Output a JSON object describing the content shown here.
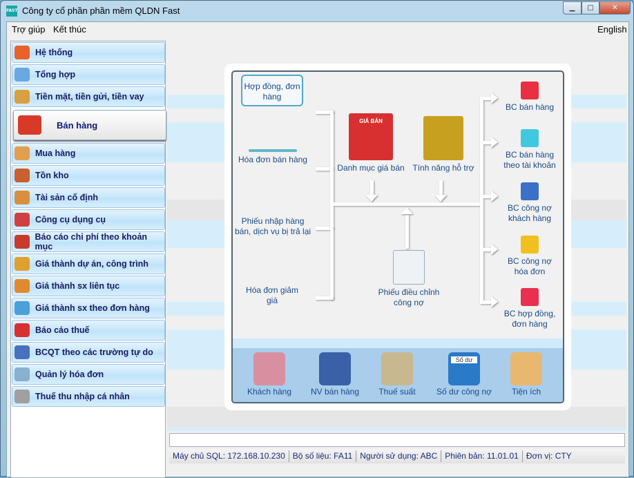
{
  "window": {
    "title": "Công ty cổ phần phần mềm QLDN Fast",
    "app_icon": "FAST",
    "controls": [
      "minimize",
      "maximize",
      "close"
    ]
  },
  "menu": {
    "items": [
      "Trợ giúp",
      "Kết thúc"
    ],
    "language": "English"
  },
  "sidebar": {
    "items": [
      {
        "label": "Hệ thống",
        "icon": "gears-icon",
        "color": "#e8622a"
      },
      {
        "label": "Tổng hợp",
        "icon": "chart-icon",
        "color": "#6aa8e0"
      },
      {
        "label": "Tiền mặt, tiền gửi, tiền vay",
        "icon": "bank-icon",
        "color": "#d8a040"
      },
      {
        "label": "Bán hàng",
        "icon": "truck-icon",
        "color": "#d83a2a",
        "active": true
      },
      {
        "label": "Mua hàng",
        "icon": "basket-icon",
        "color": "#e0a050"
      },
      {
        "label": "Tồn kho",
        "icon": "warehouse-icon",
        "color": "#c86030"
      },
      {
        "label": "Tài sản cố định",
        "icon": "house-icon",
        "color": "#d89040"
      },
      {
        "label": "Công cụ dụng cụ",
        "icon": "toolbox-icon",
        "color": "#d04040"
      },
      {
        "label": "Báo cáo chi phí theo khoản mục",
        "icon": "binders-icon",
        "color": "#c83a2a"
      },
      {
        "label": "Giá thành dự án, công trình",
        "icon": "buildings-icon",
        "color": "#e0a030"
      },
      {
        "label": "Giá thành sx liên tục",
        "icon": "cog-icon",
        "color": "#e08a30"
      },
      {
        "label": "Giá thành sx theo đơn hàng",
        "icon": "calculator-icon",
        "color": "#4aa0d8"
      },
      {
        "label": "Báo cáo thuế",
        "icon": "percent-icon",
        "color": "#d83030"
      },
      {
        "label": "BCQT theo các trường tự do",
        "icon": "cart-icon",
        "color": "#4a70c0"
      },
      {
        "label": "Quản lý hóa đơn",
        "icon": "invoice-icon",
        "color": "#8ab0d0"
      },
      {
        "label": "Thuế thu nhập cá nhân",
        "icon": "person-icon",
        "color": "#a0a0a0"
      }
    ]
  },
  "diagram": {
    "left": [
      {
        "label": "Hợp đồng, đơn hàng",
        "icon": "contract-icon",
        "selected": true
      },
      {
        "label": "Hóa đơn bán hàng",
        "icon": "invoice-icon"
      },
      {
        "label": "Phiếu nhập hàng bán, dịch vụ bị trả lại",
        "icon": "truck-icon"
      },
      {
        "label": "Hóa đơn giảm giá",
        "icon": "discount-bag-icon"
      }
    ],
    "middle": [
      {
        "label": "Danh mục giá bán",
        "icon": "price-folder-icon",
        "badge": "GIÁ BÁN"
      },
      {
        "label": "Tính năng hỗ trợ",
        "icon": "dollar-briefcase-icon"
      },
      {
        "label": "Phiếu điều chỉnh công nợ",
        "icon": "adjustment-form-icon"
      }
    ],
    "right": [
      {
        "label": "BC bán hàng",
        "color": "#e83040"
      },
      {
        "label": "BC bán hàng theo tài khoản",
        "color": "#40c8e0"
      },
      {
        "label": "BC công nợ khách hàng",
        "color": "#3a70c8"
      },
      {
        "label": "BC công nợ hóa đơn",
        "color": "#f0c020"
      },
      {
        "label": "BC hợp đồng, đơn hàng",
        "color": "#e83050"
      }
    ],
    "bottom": [
      {
        "label": "Khách hàng",
        "icon": "customers-icon",
        "color": "#d890a0"
      },
      {
        "label": "NV bán hàng",
        "icon": "sales-staff-icon",
        "color": "#3a60a8"
      },
      {
        "label": "Thuế suất",
        "icon": "tax-money-icon",
        "color": "#c8b890"
      },
      {
        "label": "Số dư công nợ",
        "icon": "balance-book-icon",
        "color": "#2a7ac8",
        "badge": "Số dư"
      },
      {
        "label": "Tiện ích",
        "icon": "tools-box-icon",
        "color": "#e8b870"
      }
    ]
  },
  "status": {
    "input_value": "",
    "fields": [
      "Máy chủ SQL: 172.168.10.230",
      "Bộ số liệu: FA11",
      "Người sử dụng: ABC",
      "Phiên bản: 11.01.01",
      "Đơn vị: CTY"
    ]
  }
}
